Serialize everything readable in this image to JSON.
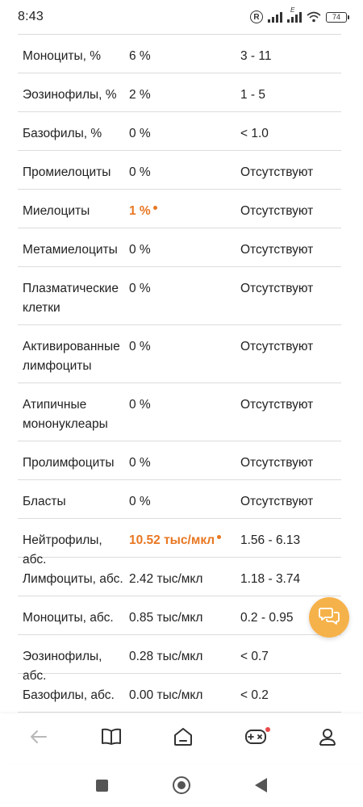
{
  "status_bar": {
    "time": "8:43",
    "r_label": "R",
    "network_label": "E",
    "battery": "74"
  },
  "rows": [
    {
      "name": "Моноциты, %",
      "value": "6 %",
      "ref": "3 - 11",
      "warn": false
    },
    {
      "name": "Эозинофилы, %",
      "value": "2 %",
      "ref": "1 - 5",
      "warn": false
    },
    {
      "name": "Базофилы, %",
      "value": "0 %",
      "ref": "< 1.0",
      "warn": false
    },
    {
      "name": "Промиелоциты",
      "value": "0 %",
      "ref": "Отсутствуют",
      "warn": false
    },
    {
      "name": "Миелоциты",
      "value": "1 %",
      "ref": "Отсутствуют",
      "warn": true
    },
    {
      "name": "Метамиелоциты",
      "value": "0 %",
      "ref": "Отсутствуют",
      "warn": false
    },
    {
      "name": "Плазматические клетки",
      "value": "0 %",
      "ref": "Отсутствуют",
      "warn": false
    },
    {
      "name": "Активированные лимфоциты",
      "value": "0 %",
      "ref": "Отсутствуют",
      "warn": false
    },
    {
      "name": "Атипичные мононуклеары",
      "value": "0 %",
      "ref": "Отсутствуют",
      "warn": false
    },
    {
      "name": "Пролимфоциты",
      "value": "0 %",
      "ref": "Отсутствуют",
      "warn": false
    },
    {
      "name": "Бласты",
      "value": "0 %",
      "ref": "Отсутствуют",
      "warn": false
    },
    {
      "name": "Нейтрофилы, абс.",
      "value": "10.52 тыс/мкл",
      "ref": "1.56 - 6.13",
      "warn": true
    },
    {
      "name": "Лимфоциты, абс.",
      "value": "2.42 тыс/мкл",
      "ref": "1.18 - 3.74",
      "warn": false
    },
    {
      "name": "Моноциты, абс.",
      "value": "0.85 тыс/мкл",
      "ref": "0.2 - 0.95",
      "warn": false
    },
    {
      "name": "Эозинофилы, абс.",
      "value": "0.28 тыс/мкл",
      "ref": "< 0.7",
      "warn": false
    },
    {
      "name": "Базофилы, абс.",
      "value": "0.00 тыс/мкл",
      "ref": "< 0.2",
      "warn": false
    }
  ],
  "colors": {
    "warning": "#e87722",
    "fab": "#f6b24a",
    "notification_dot": "#e84a4a"
  },
  "bottom_nav": {
    "items": [
      "back-arrow-icon",
      "book-icon",
      "home-icon",
      "gamepad-icon",
      "profile-icon"
    ],
    "gamepad_has_notification": true
  },
  "fab": {
    "icon": "chat-bubbles-icon"
  }
}
